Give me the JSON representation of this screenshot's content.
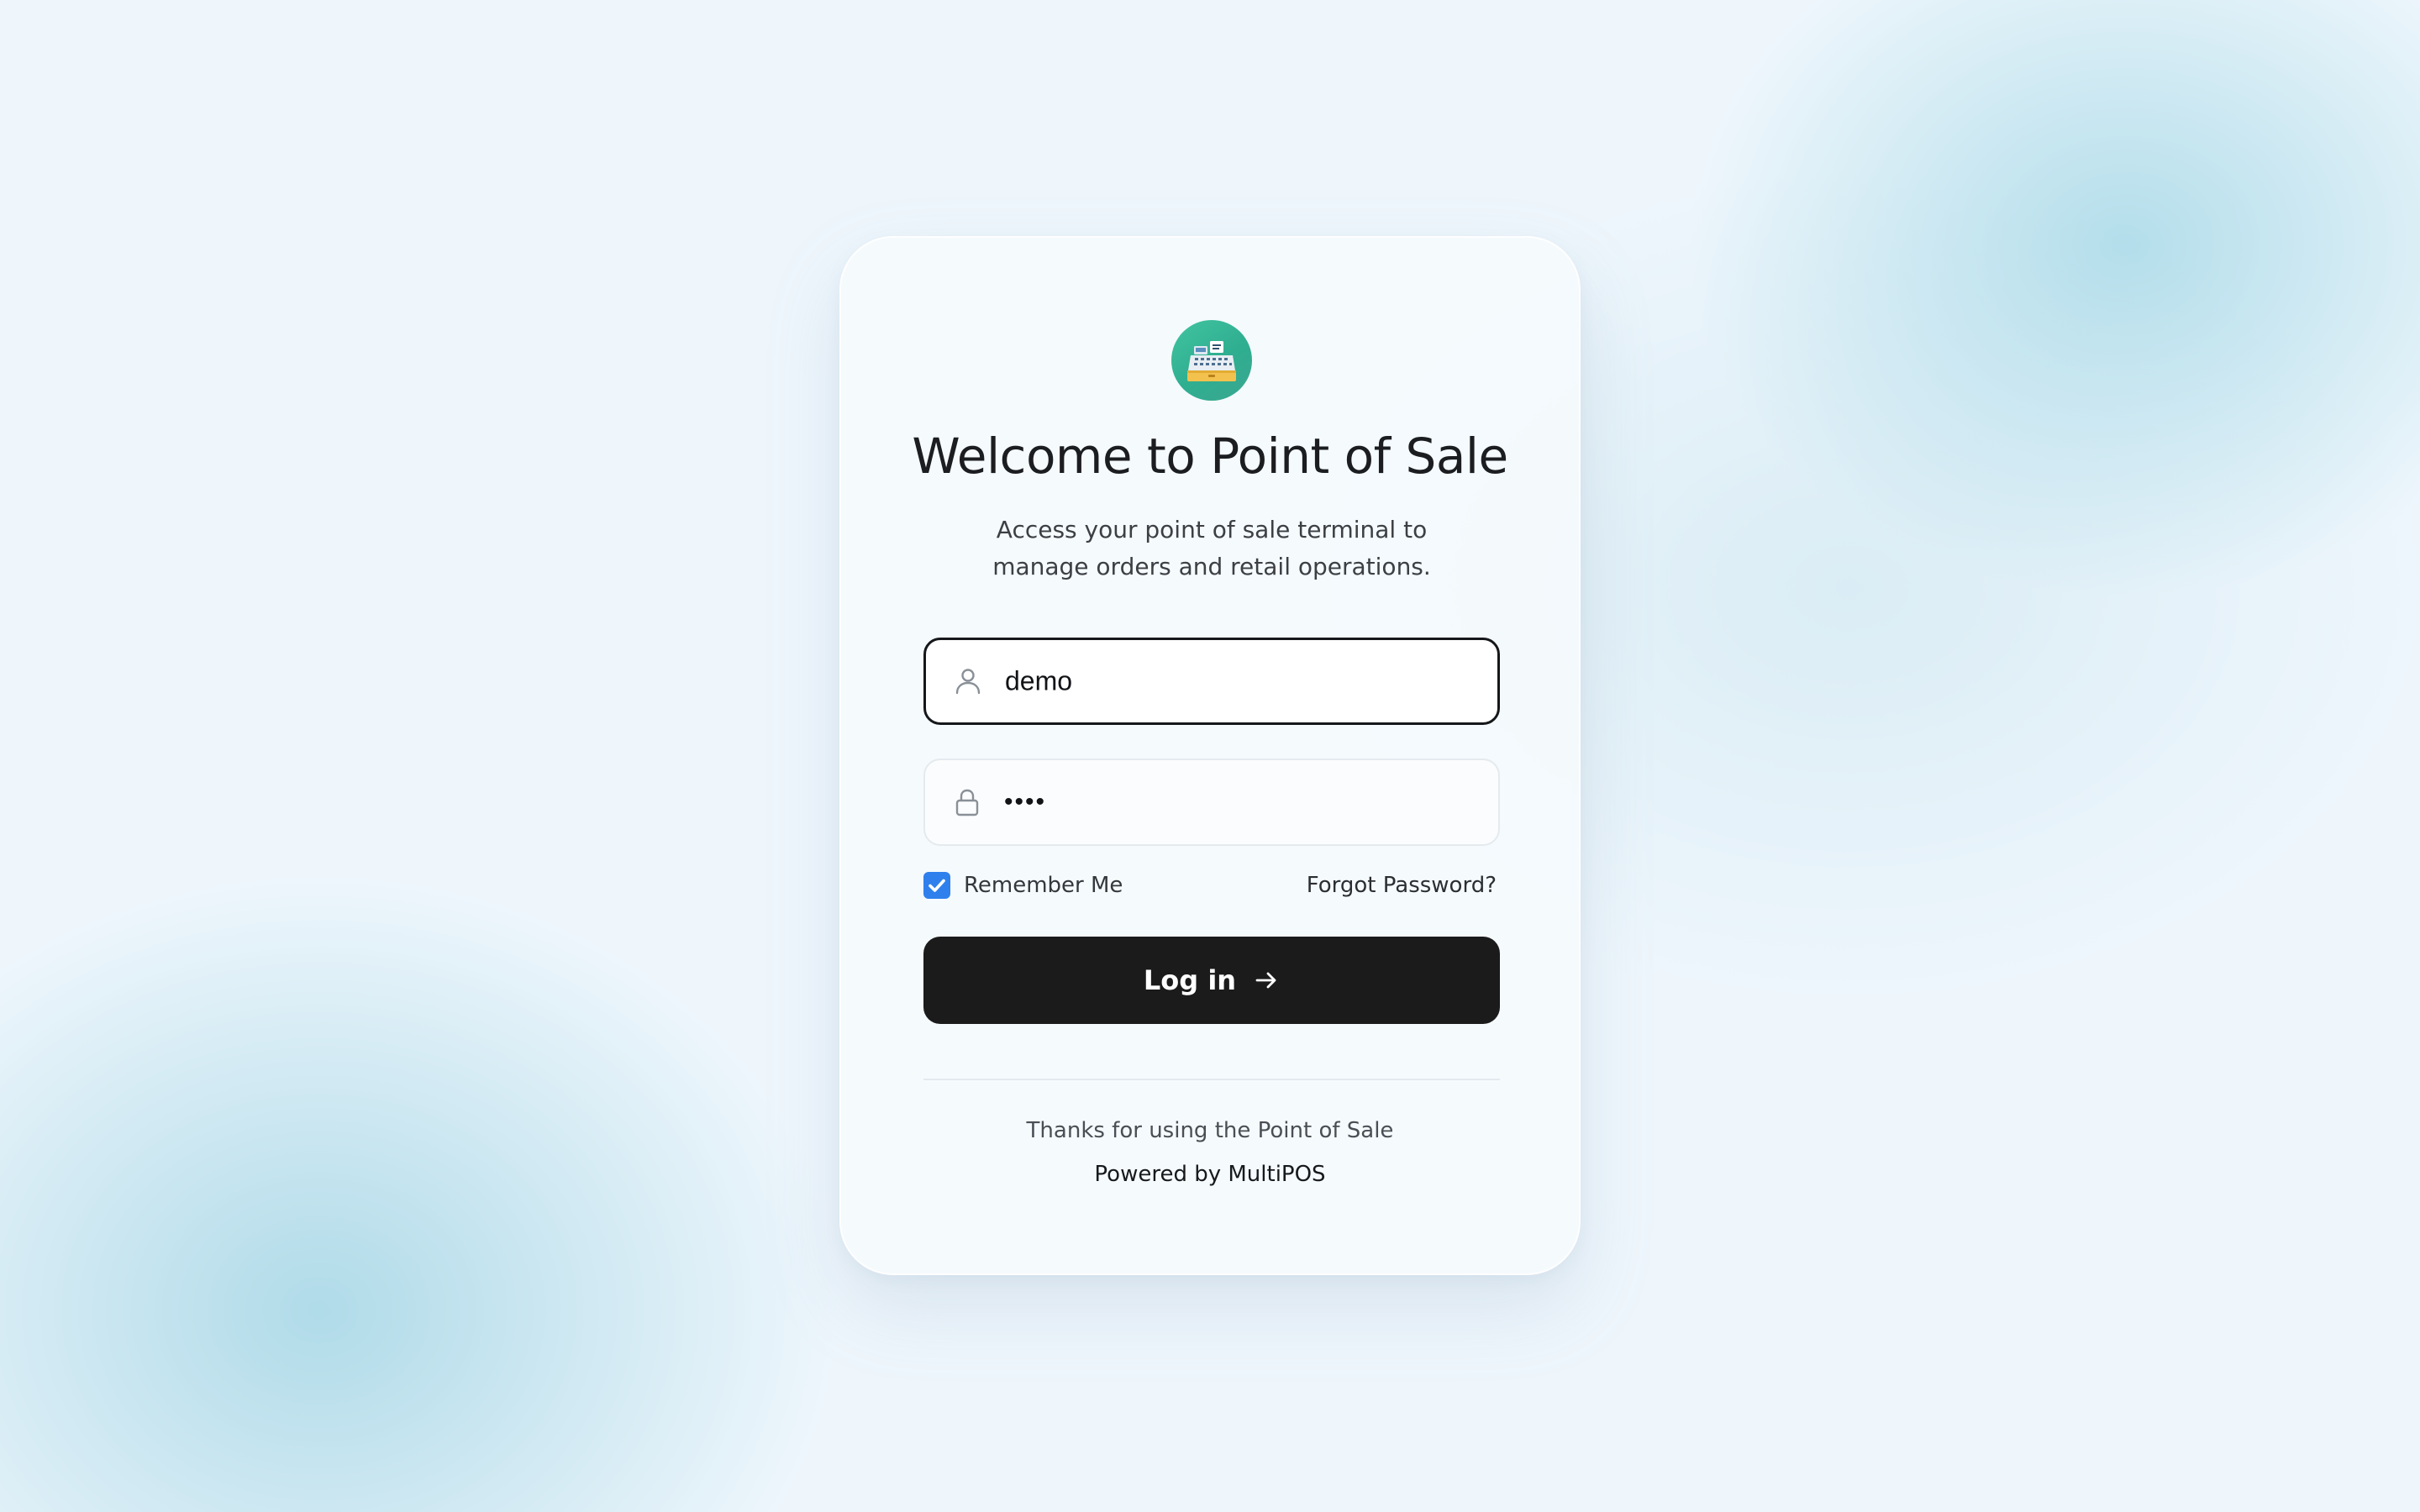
{
  "brand": {
    "logo_icon": "cash-register-icon",
    "accent_color": "#34b896"
  },
  "login": {
    "title": "Welcome to Point of Sale",
    "subtitle": "Access your point of sale terminal to manage orders and retail operations.",
    "username": {
      "icon": "user-icon",
      "value": "demo"
    },
    "password": {
      "icon": "lock-icon",
      "value": "••••"
    },
    "remember_me": {
      "label": "Remember Me",
      "checked": true,
      "color": "#2f80ed"
    },
    "forgot_password_label": "Forgot Password?",
    "submit": {
      "label": "Log in",
      "icon": "arrow-right-icon",
      "background": "#1b1b1b"
    }
  },
  "footer": {
    "thanks": "Thanks for using the Point of Sale",
    "powered_by": "Powered by MultiPOS"
  }
}
